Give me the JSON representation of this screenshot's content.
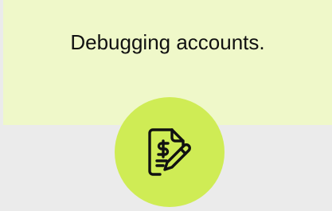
{
  "panel": {
    "message": "Debugging accounts."
  },
  "badge": {
    "icon": "invoice-edit-icon"
  },
  "colors": {
    "background": "#ebebeb",
    "panel": "#eff8c9",
    "badge": "#cfec55",
    "icon_stroke": "#111111"
  }
}
